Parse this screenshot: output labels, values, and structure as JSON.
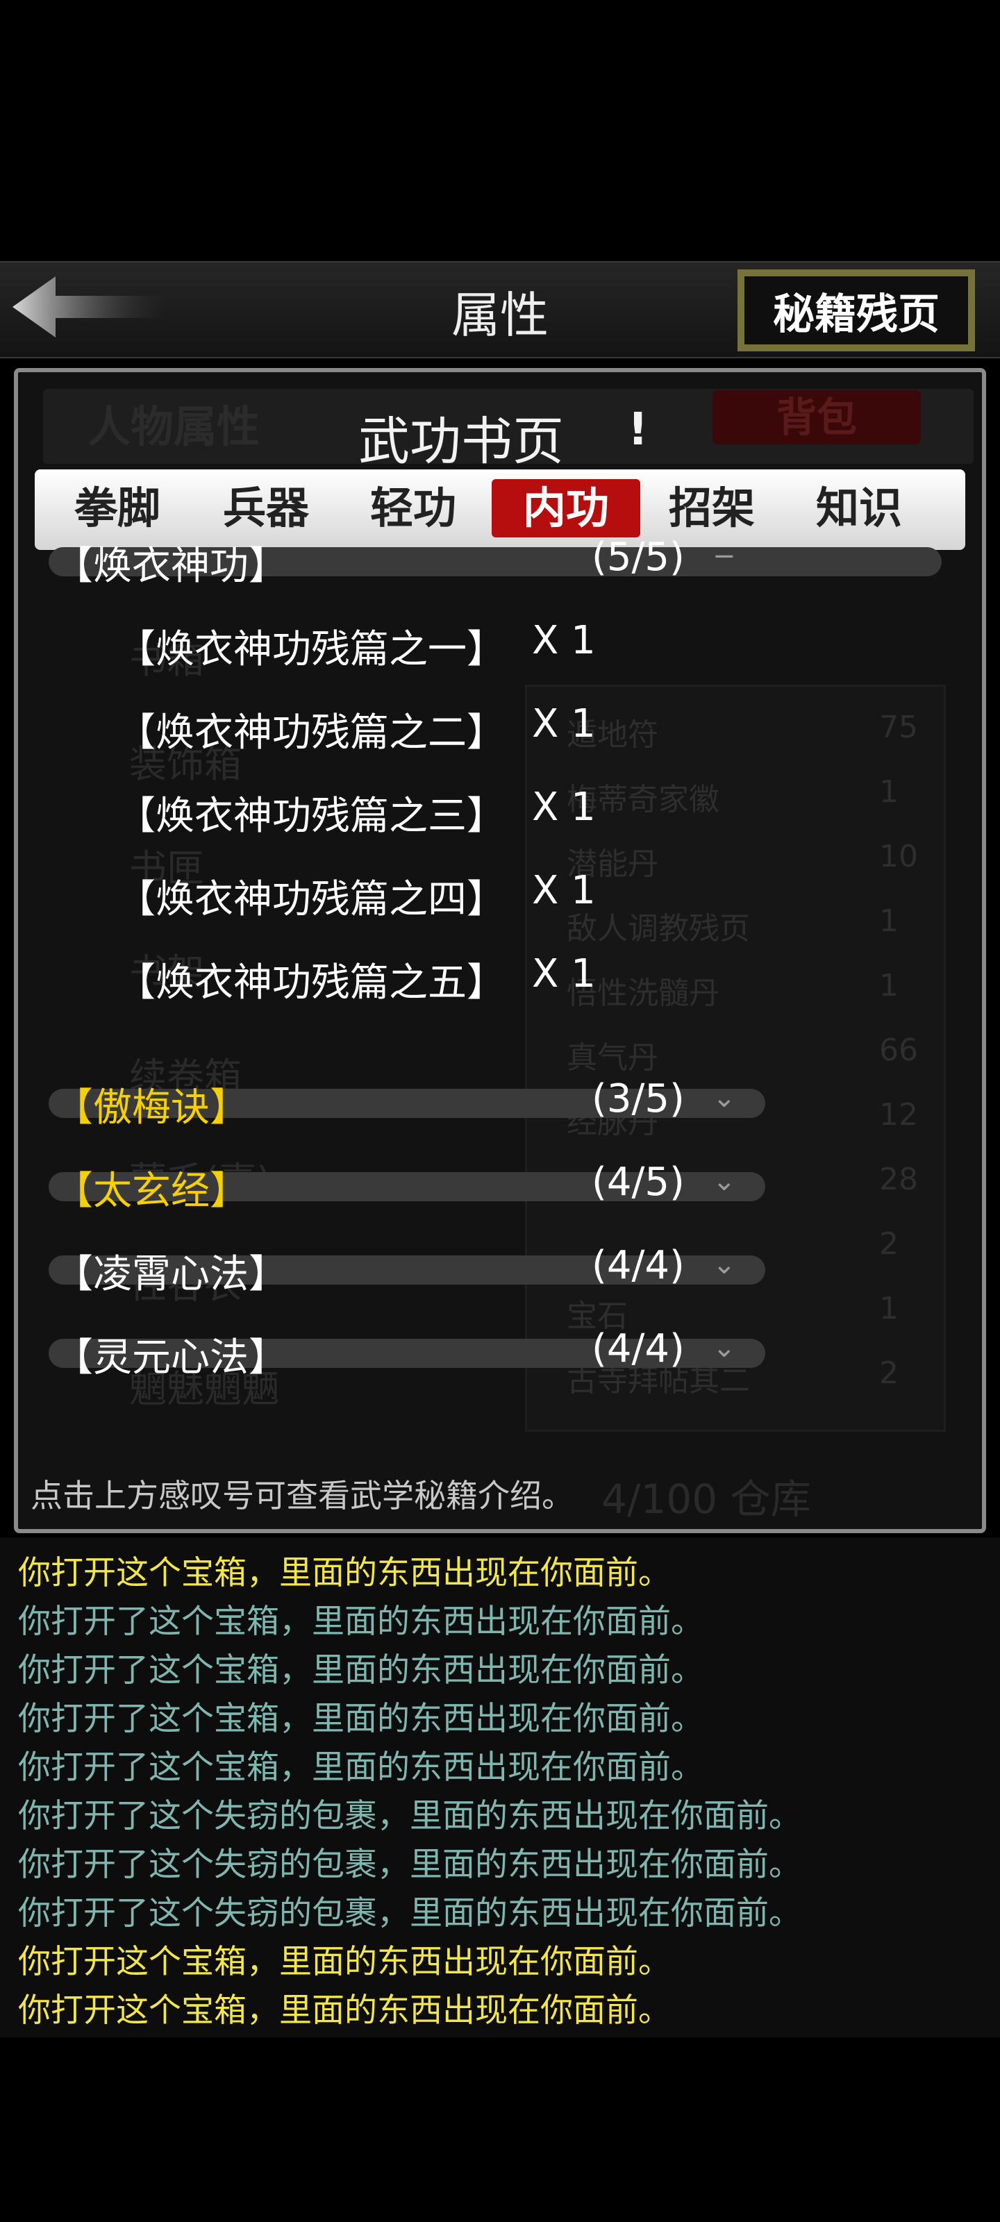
{
  "header": {
    "title": "属性",
    "secret_pages_button": "秘籍残页"
  },
  "background": {
    "attr_label": "人物属性",
    "bag_label": "背包",
    "left_items": [
      "书箱",
      "装饰箱",
      "书匣",
      "书架",
      "续卷箱",
      "蒙毛(壹)",
      "性谷衣",
      "魍魅魍魉"
    ],
    "table_rows": [
      {
        "name": "遁地符",
        "count": "75"
      },
      {
        "name": "梅蒂奇家徽",
        "count": "1"
      },
      {
        "name": "潜能丹",
        "count": "10"
      },
      {
        "name": "敌人调教残页",
        "count": "1"
      },
      {
        "name": "悟性洗髓丹",
        "count": "1"
      },
      {
        "name": "真气丹",
        "count": "66"
      },
      {
        "name": "经脉丹",
        "count": "12"
      },
      {
        "name": "",
        "count": "28"
      },
      {
        "name": "",
        "count": "2"
      },
      {
        "name": "宝石",
        "count": "1"
      },
      {
        "name": "古寺拜帖其二",
        "count": "2"
      }
    ],
    "storage": "4/100 仓库"
  },
  "book": {
    "title": "武功书页",
    "exclaim": "!"
  },
  "tabs": [
    {
      "label": "拳脚",
      "active": false
    },
    {
      "label": "兵器",
      "active": false
    },
    {
      "label": "轻功",
      "active": false
    },
    {
      "label": "内功",
      "active": true
    },
    {
      "label": "招架",
      "active": false
    },
    {
      "label": "知识",
      "active": false
    }
  ],
  "sections": [
    {
      "title": "【焕衣神功】",
      "count": "(5/5)",
      "toggle": "−",
      "gold": false,
      "expanded": true,
      "entries": [
        {
          "name": "【焕衣神功残篇之一】",
          "qty": "X 1"
        },
        {
          "name": "【焕衣神功残篇之二】",
          "qty": "X 1"
        },
        {
          "name": "【焕衣神功残篇之三】",
          "qty": "X 1"
        },
        {
          "name": "【焕衣神功残篇之四】",
          "qty": "X 1"
        },
        {
          "name": "【焕衣神功残篇之五】",
          "qty": "X 1"
        }
      ]
    },
    {
      "title": "【傲梅诀】",
      "count": "(3/5)",
      "toggle": "⌄",
      "gold": true,
      "expanded": false,
      "entries": []
    },
    {
      "title": "【太玄经】",
      "count": "(4/5)",
      "toggle": "⌄",
      "gold": true,
      "expanded": false,
      "entries": []
    },
    {
      "title": "【凌霄心法】",
      "count": "(4/4)",
      "toggle": "⌄",
      "gold": false,
      "expanded": false,
      "entries": []
    },
    {
      "title": "【灵元心法】",
      "count": "(4/4)",
      "toggle": "⌄",
      "gold": false,
      "expanded": false,
      "entries": []
    }
  ],
  "hint": "点击上方感叹号可查看武学秘籍介绍。",
  "log": [
    {
      "text": "你打开这个宝箱，里面的东西出现在你面前。",
      "color": "#f3e64a"
    },
    {
      "text": "你打开了这个宝箱，里面的东西出现在你面前。",
      "color": "#7fb6b0"
    },
    {
      "text": "你打开了这个宝箱，里面的东西出现在你面前。",
      "color": "#7fb6b0"
    },
    {
      "text": "你打开了这个宝箱，里面的东西出现在你面前。",
      "color": "#7fb6b0"
    },
    {
      "text": "你打开了这个宝箱，里面的东西出现在你面前。",
      "color": "#7fb6b0"
    },
    {
      "text": "你打开了这个失窃的包裹，里面的东西出现在你面前。",
      "color": "#7fb6b0"
    },
    {
      "text": "你打开了这个失窃的包裹，里面的东西出现在你面前。",
      "color": "#7fb6b0"
    },
    {
      "text": "你打开了这个失窃的包裹，里面的东西出现在你面前。",
      "color": "#7fb6b0"
    },
    {
      "text": "你打开这个宝箱，里面的东西出现在你面前。",
      "color": "#f3e64a"
    },
    {
      "text": "你打开这个宝箱，里面的东西出现在你面前。",
      "color": "#f3e64a"
    }
  ],
  "colors": {
    "active_tab": "#b60e0e",
    "gold_title": "#f7d000",
    "log_yellow": "#f3e64a",
    "log_teal": "#7fb6b0"
  }
}
